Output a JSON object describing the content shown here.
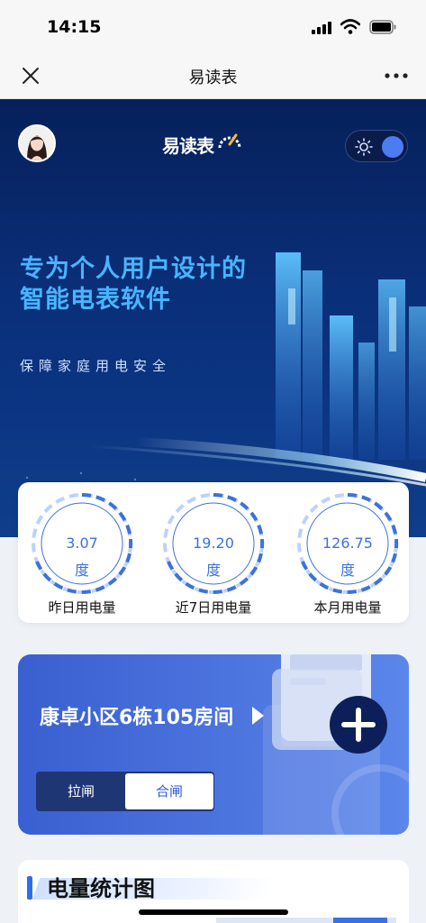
{
  "status_bar": {
    "time": "14:15"
  },
  "nav": {
    "title": "易读表"
  },
  "hero": {
    "logo_text": "易读表",
    "headline_line1": "专为个人用户设计的",
    "headline_line2": "智能电表软件",
    "subtitle": "保障家庭用电安全",
    "theme_toggle": "on"
  },
  "stats": [
    {
      "value": "3.07",
      "unit": "度",
      "label": "昨日用电量"
    },
    {
      "value": "19.20",
      "unit": "度",
      "label": "近7日用电量"
    },
    {
      "value": "126.75",
      "unit": "度",
      "label": "本月用电量"
    }
  ],
  "room": {
    "name": "康卓小区6栋105房间",
    "switch_off_label": "拉闸",
    "switch_on_label": "合闸",
    "selected": "合闸"
  },
  "chart_section": {
    "title": "电量统计图"
  },
  "colors": {
    "accent": "#2f6df0",
    "hero_text": "#49b4ff",
    "gauge": "#3d72d8"
  }
}
